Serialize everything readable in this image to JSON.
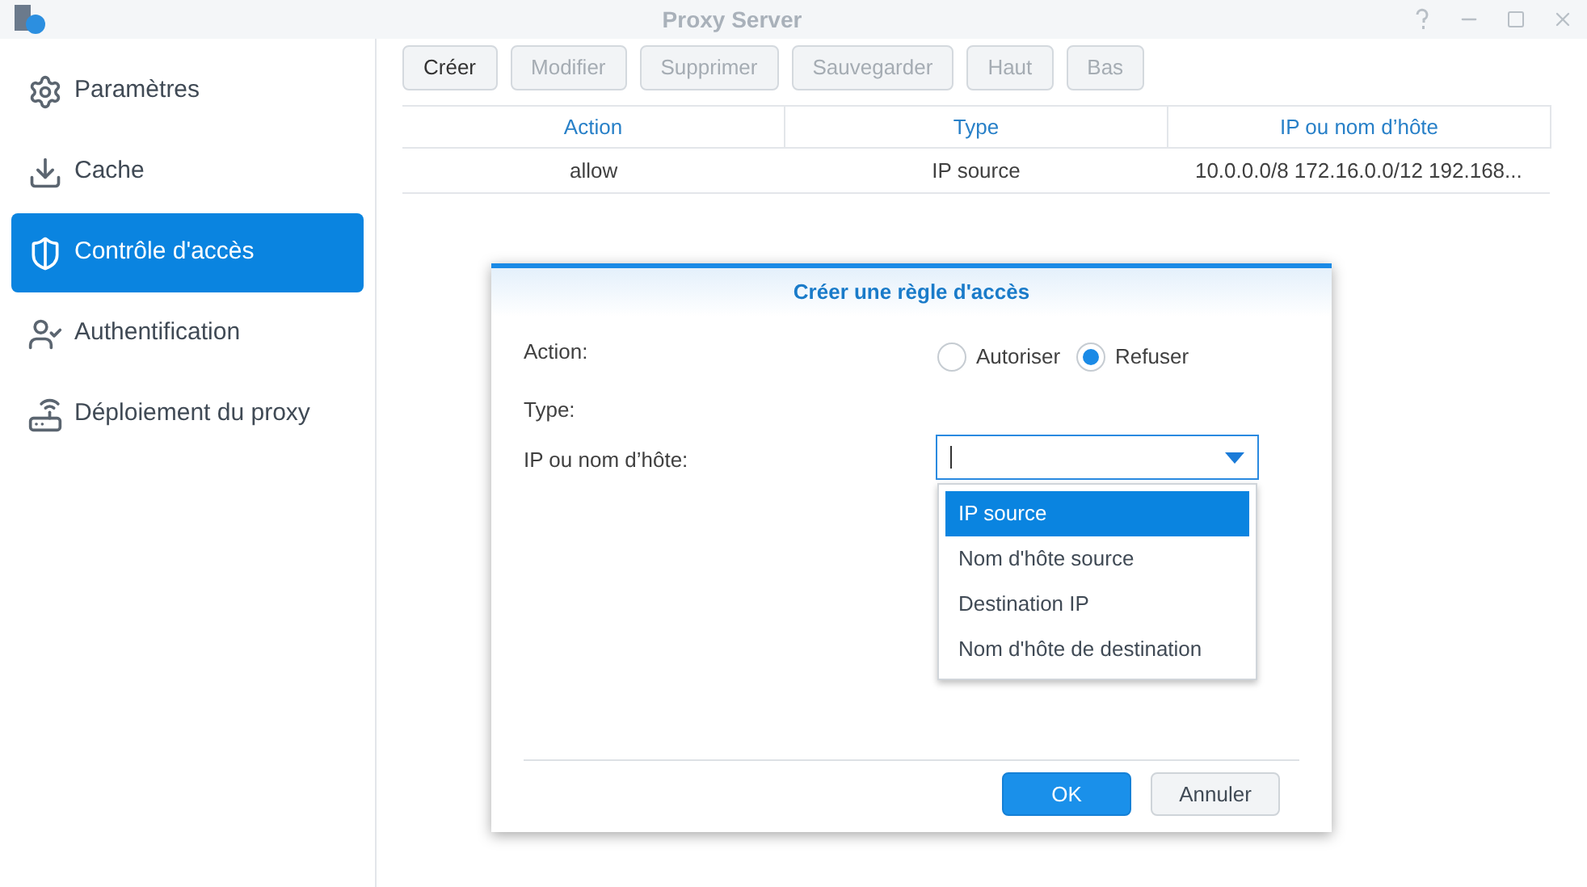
{
  "window": {
    "title": "Proxy Server"
  },
  "sidebar": {
    "items": [
      {
        "label": "Paramètres",
        "selected": false
      },
      {
        "label": "Cache",
        "selected": false
      },
      {
        "label": "Contrôle d'accès",
        "selected": true
      },
      {
        "label": "Authentification",
        "selected": false
      },
      {
        "label": "Déploiement du proxy",
        "selected": false
      }
    ]
  },
  "toolbar": [
    {
      "label": "Créer",
      "disabled": false
    },
    {
      "label": "Modifier",
      "disabled": true
    },
    {
      "label": "Supprimer",
      "disabled": true
    },
    {
      "label": "Sauvegarder",
      "disabled": true
    },
    {
      "label": "Haut",
      "disabled": true
    },
    {
      "label": "Bas",
      "disabled": true
    }
  ],
  "table": {
    "columns": [
      "Action",
      "Type",
      "IP ou nom d’hôte"
    ],
    "rows": [
      [
        "allow",
        "IP source",
        "10.0.0.0/8 172.16.0.0/12 192.168..."
      ]
    ]
  },
  "dialog": {
    "title": "Créer une règle d'accès",
    "action_label": "Action:",
    "radios": [
      {
        "label": "Autoriser",
        "selected": false
      },
      {
        "label": "Refuser",
        "selected": true
      }
    ],
    "type_label": "Type:",
    "host_label": "IP ou nom d’hôte:",
    "options": [
      {
        "label": "IP source",
        "selected": true
      },
      {
        "label": "Nom d'hôte source",
        "selected": false
      },
      {
        "label": "Destination IP",
        "selected": false
      },
      {
        "label": "Nom d'hôte de destination",
        "selected": false
      }
    ],
    "buttons": [
      {
        "label": "OK",
        "kind": "primary"
      },
      {
        "label": "Annuler",
        "kind": "secondary"
      }
    ]
  }
}
